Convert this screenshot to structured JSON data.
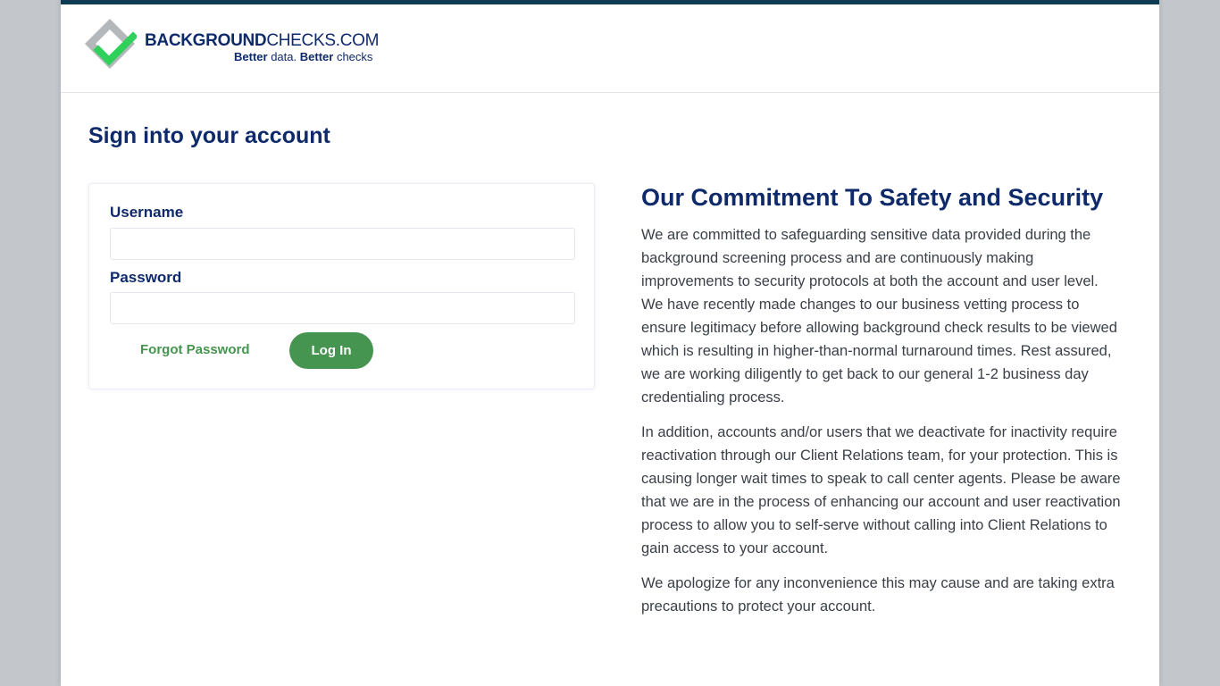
{
  "header": {
    "brand_bold": "BACKGROUND",
    "brand_light": "CHECKS.COM",
    "tagline_part1": "Better",
    "tagline_part2": "data.",
    "tagline_part3": "Better",
    "tagline_part4": "checks",
    "logo_icon": "diamond-checkmark-logo"
  },
  "page_title": "Sign into your account",
  "login": {
    "username_label": "Username",
    "username_value": "",
    "password_label": "Password",
    "password_value": "",
    "forgot_label": "Forgot Password",
    "login_label": "Log In"
  },
  "notice": {
    "title": "Our Commitment To Safety and Security",
    "paragraphs": [
      "We are committed to safeguarding sensitive data provided during the background screening process and are continuously making improvements to security protocols at both the account and user level. We have recently made changes to our business vetting process to ensure legitimacy before allowing background check results to be viewed which is resulting in higher-than-normal turnaround times. Rest assured, we are working diligently to get back to our general 1-2 business day credentialing process.",
      "In addition, accounts and/or users that we deactivate for inactivity require reactivation through our Client Relations team, for your protection. This is causing longer wait times to speak to call center agents. Please be aware that we are in the process of enhancing our account and user reactivation process to allow you to self-serve without calling into Client Relations to gain access to your account.",
      "We apologize for any inconvenience this may cause and are taking extra precautions to protect your account."
    ]
  },
  "colors": {
    "navy": "#0f2a6b",
    "green": "#45944f",
    "top_bar": "#0e3a52",
    "background": "#c3c7cb"
  }
}
